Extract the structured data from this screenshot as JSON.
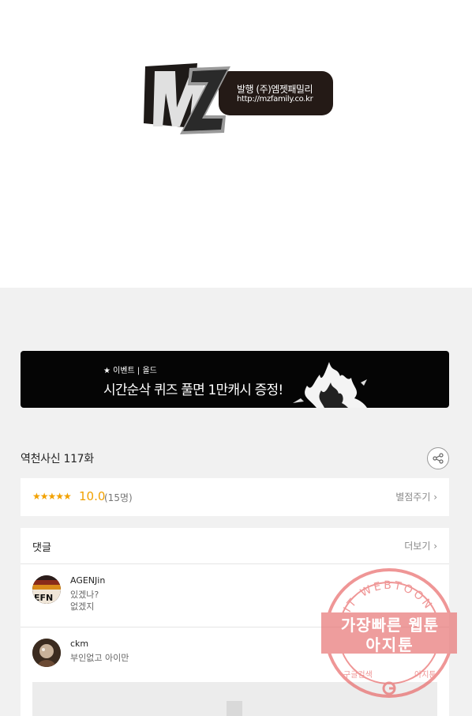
{
  "publisher": {
    "publisher_line": "발행 (주)엠젯패밀리",
    "url_line": "http://mzfamily.co.kr"
  },
  "banner": {
    "tag": "★ 이벤트 | 올드",
    "headline": "시간순삭 퀴즈 풀면 1만캐시 증정!"
  },
  "episode": {
    "title": "역천사신 117화"
  },
  "rating": {
    "stars": "★★★★★",
    "score": "10.0",
    "count": "(15명)",
    "rate_label": "별점주기 ›"
  },
  "comments": {
    "title": "댓글",
    "more_label": "더보기 ›",
    "items": [
      {
        "user": "AGENJin",
        "line1": "있겠나?",
        "line2": "없겠지"
      },
      {
        "user": "ckm",
        "line1": "부인없고 아이만"
      }
    ]
  },
  "watermark": {
    "ring_text": "AGIT WEBTOON",
    "line1": "가장빠른 웹툰",
    "line2": "아지툰",
    "bottom_left": "구글검색",
    "bottom_right": "아지툰"
  },
  "colors": {
    "accent_rating": "#f2a100",
    "watermark": "#e23b3b"
  }
}
